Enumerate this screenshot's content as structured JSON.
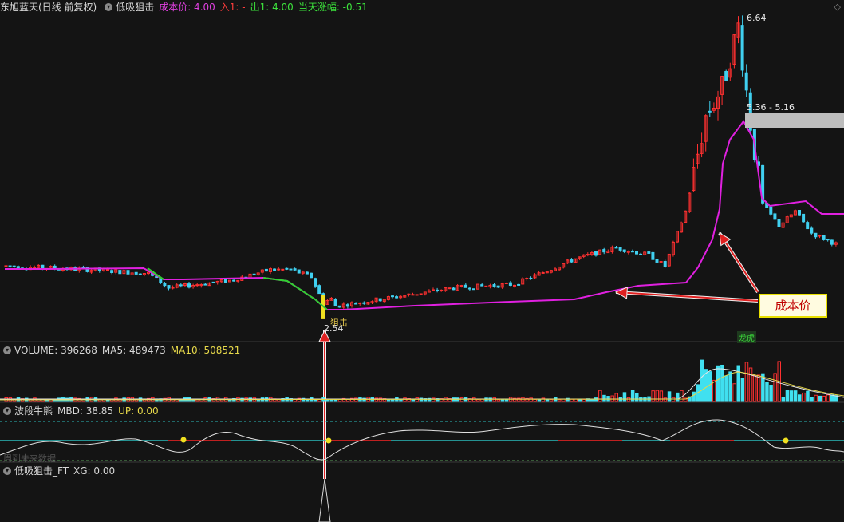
{
  "header": {
    "stock_name": "东旭蓝天(日线 前复权)",
    "indicator_name": "低吸狙击",
    "cost_label": "成本价: 4.00",
    "in_label": "入1: -",
    "out_label": "出1: 4.00",
    "change_label": "当天涨幅: -0.51"
  },
  "volume_panel": {
    "volume_label": "VOLUME: 396268",
    "ma5_label": "MA5: 489473",
    "ma10_label": "MA10: 508521"
  },
  "osc_panel": {
    "name": "波段牛熊",
    "mbd_label": "MBD: 38.85",
    "up_label": "UP: 0.00",
    "wait_label": "周到未来数据"
  },
  "xg_panel": {
    "name": "低吸狙击_FT",
    "xg_label": "XG: 0.00"
  },
  "annotations": {
    "high_price": "6.64",
    "low_price": "2.54",
    "range_label": "5.36 - 5.16",
    "cost_callout": "成本价",
    "signal_label": "狙击",
    "lhb_label": "龙虎"
  },
  "colors": {
    "up": "#ff3030",
    "down": "#40d0f0",
    "cost_line": "#e020e0",
    "cost_line_down": "#30d030",
    "arrow": "#e02020",
    "signal": "#f0e020",
    "background": "#141414"
  },
  "icons": {
    "circle_toggle": "circle-toggle-icon",
    "corner": "diamond-icon"
  }
}
